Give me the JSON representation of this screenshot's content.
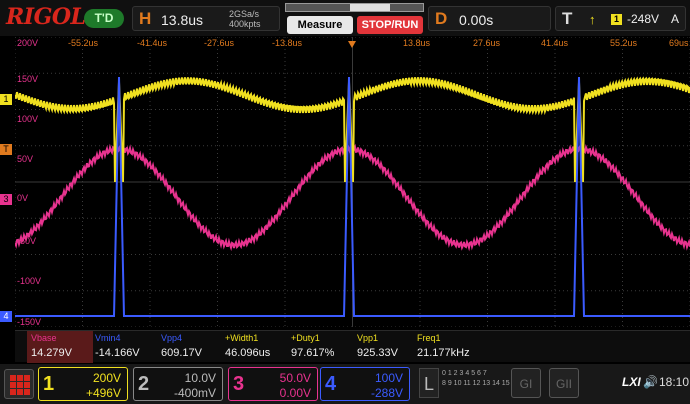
{
  "top": {
    "logo": "RIGOL",
    "status": "T'D",
    "horizontal": {
      "letter": "H",
      "timebase": "13.8us",
      "sample_rate": "2GSa/s",
      "mem_depth": "400kpts"
    },
    "acq_meter": {
      "window_start": 0.47,
      "window_width": 0.29
    },
    "measure_label": "Measure",
    "stoprun_label": "STOP/RUN",
    "delay": {
      "letter": "D",
      "value": "0.00s"
    },
    "trigger": {
      "letter": "T",
      "source": "1",
      "level": "-248V",
      "mode": "A"
    }
  },
  "time_labels": [
    "-55.2us",
    "-41.4us",
    "-27.6us",
    "-13.8us",
    "13.8us",
    "27.6us",
    "41.4us",
    "55.2us",
    "69us"
  ],
  "volt_labels": [
    "200V",
    "150V",
    "100V",
    "50V",
    "0V",
    "-50V",
    "-100V",
    "-150V"
  ],
  "markers": {
    "ch1": "1",
    "trig": "T",
    "ch3": "3",
    "ch4": "4"
  },
  "measurements": [
    {
      "label": "Vbase",
      "value": "14.279V",
      "color": "#e8338f"
    },
    {
      "label": "Vmin4",
      "value": "-14.166V",
      "color": "#3b5bff"
    },
    {
      "label": "Vpp4",
      "value": "609.17V",
      "color": "#3b5bff"
    },
    {
      "label": "+Width1",
      "value": "46.096us",
      "color": "#f0e020"
    },
    {
      "label": "+Duty1",
      "value": "97.617%",
      "color": "#f0e020"
    },
    {
      "label": "Vpp1",
      "value": "925.33V",
      "color": "#f0e020"
    },
    {
      "label": "Freq1",
      "value": "21.177kHz",
      "color": "#f0e020"
    }
  ],
  "channels": [
    {
      "num": "1",
      "scale": "200V",
      "offset": "+496V",
      "color": "#f0e020",
      "bg": "#f0e020",
      "text": "#000"
    },
    {
      "num": "2",
      "scale": "10.0V",
      "offset": "-400mV",
      "color": "#888",
      "bg": "#2a2a2a",
      "text": "#bbb"
    },
    {
      "num": "3",
      "scale": "50.0V",
      "offset": "0.00V",
      "color": "#e8338f",
      "bg": "#e8338f",
      "text": "#fff"
    },
    {
      "num": "4",
      "scale": "100V",
      "offset": "-288V",
      "color": "#3b5bff",
      "bg": "#3b5bff",
      "text": "#fff"
    }
  ],
  "logic": {
    "letter": "L",
    "row1": "0 1 2 3 4 5 6 7",
    "row2": "8 9 10 11 12 13 14 15"
  },
  "gen1": "GI",
  "gen2": "GII",
  "lxi": "LXI",
  "time": "18:10",
  "colors": {
    "ch1": "#f0e020",
    "ch3": "#e8338f",
    "ch4": "#3b5bff",
    "accent": "#e07a1e",
    "grid": "#3a3a3a"
  }
}
